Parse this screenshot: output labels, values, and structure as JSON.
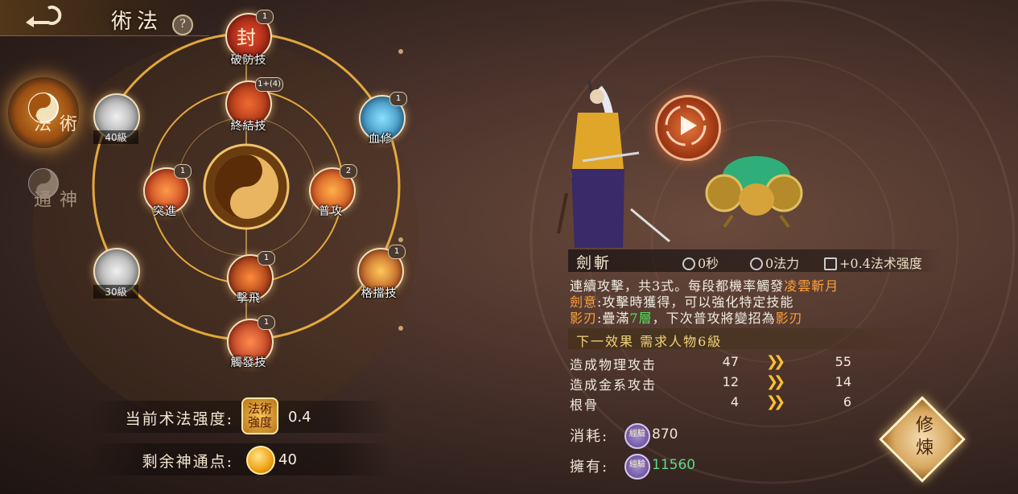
{
  "header": {
    "title": "術法",
    "help": "?"
  },
  "side_tabs": [
    {
      "label": "術法",
      "active": true
    },
    {
      "label": "神通",
      "active": false
    }
  ],
  "skills": {
    "pofang": {
      "name": "破防技",
      "level": "1",
      "glyph": "封"
    },
    "zhongjie": {
      "name": "終結技",
      "level": "1+(4)"
    },
    "xuexiu": {
      "name": "血修",
      "level": "1"
    },
    "tujin": {
      "name": "突進",
      "level": "1"
    },
    "pugong": {
      "name": "普攻",
      "level": "2"
    },
    "jifei": {
      "name": "擊飛",
      "level": "1"
    },
    "gedang": {
      "name": "格擋技",
      "level": "1"
    },
    "chufa": {
      "name": "觸發技",
      "level": "1"
    }
  },
  "locked": [
    {
      "label": "40級"
    },
    {
      "label": "30級"
    }
  ],
  "stats": {
    "strength_label": "当前术法强度:",
    "strength_badge": "法術強度",
    "strength_value": "0.4",
    "points_label": "剩余神通点:",
    "points_value": "40"
  },
  "detail": {
    "name": "劍斬",
    "cooldown": "0秒",
    "mana": "0法力",
    "bonus": "+0.4法术强度",
    "line1_a": "連續攻擊，共3式。每段都機率觸發",
    "line1_b": "凌雲斬月",
    "line2_a": "劍意",
    "line2_b": ":攻擊時獲得，可以強化特定技能",
    "line3_a": "影刃",
    "line3_b": ":疊滿",
    "line3_c": "7層",
    "line3_d": "，下次普攻將變招為",
    "line3_e": "影刃",
    "next_effect": "下一效果 需求人物6級",
    "upgrades": [
      {
        "name": "造成物理攻击",
        "current": "47",
        "next": "55"
      },
      {
        "name": "造成金系攻击",
        "current": "12",
        "next": "14"
      },
      {
        "name": "根骨",
        "current": "4",
        "next": "6"
      }
    ],
    "cost_label": "消耗:",
    "cost_value": "870",
    "own_label": "擁有:",
    "own_value": "11560",
    "exp_icon": "經驗",
    "cultivate": "修煉"
  }
}
